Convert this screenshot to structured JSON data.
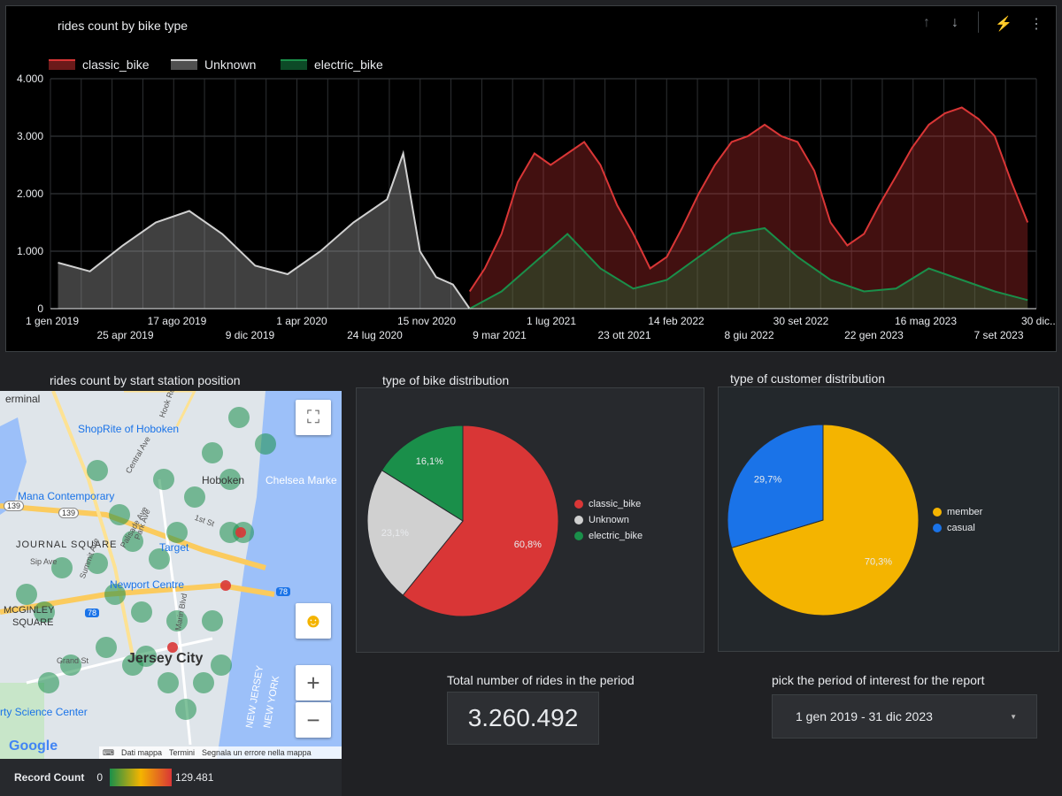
{
  "line_chart": {
    "title": "rides count by bike type",
    "legend": [
      {
        "name": "classic_bike",
        "color": "#d93636"
      },
      {
        "name": "Unknown",
        "color": "#d0d0d0"
      },
      {
        "name": "electric_bike",
        "color": "#1a8f4a"
      }
    ],
    "toolbar_icons": [
      "arrow-up-icon",
      "arrow-down-icon",
      "bolt-icon",
      "more-vert-icon"
    ],
    "y_ticks": [
      "0",
      "1.000",
      "2.000",
      "3.000",
      "4.000"
    ],
    "x_ticks_top": [
      "1 gen 2019",
      "17 ago 2019",
      "1 apr 2020",
      "15 nov 2020",
      "1 lug 2021",
      "14 feb 2022",
      "30 set 2022",
      "16 mag 2023",
      "30 dic..."
    ],
    "x_ticks_bottom": [
      "25 apr 2019",
      "9 dic 2019",
      "24 lug 2020",
      "9 mar 2021",
      "23 ott 2021",
      "8 giu 2022",
      "22 gen 2023",
      "7 set 2023"
    ]
  },
  "chart_data": [
    {
      "type": "area",
      "title": "rides count by bike type",
      "x_range": [
        "2019-01-01",
        "2023-12-31"
      ],
      "ylim": [
        0,
        4000
      ],
      "grid": true,
      "legend_position": "top-left",
      "series": [
        {
          "name": "Unknown",
          "x": [
            "2019-01",
            "2019-03",
            "2019-05",
            "2019-07",
            "2019-09",
            "2019-11",
            "2020-01",
            "2020-03",
            "2020-05",
            "2020-07",
            "2020-09",
            "2020-10",
            "2020-11",
            "2020-12",
            "2021-01",
            "2021-02"
          ],
          "values": [
            800,
            650,
            1100,
            1500,
            1700,
            1300,
            750,
            600,
            1000,
            1500,
            1900,
            2700,
            1000,
            550,
            420,
            0
          ]
        },
        {
          "name": "classic_bike",
          "x": [
            "2021-02",
            "2021-03",
            "2021-04",
            "2021-05",
            "2021-06",
            "2021-07",
            "2021-08",
            "2021-09",
            "2021-10",
            "2021-11",
            "2021-12",
            "2022-01",
            "2022-02",
            "2022-03",
            "2022-04",
            "2022-05",
            "2022-06",
            "2022-07",
            "2022-08",
            "2022-09",
            "2022-10",
            "2022-11",
            "2022-12",
            "2023-01",
            "2023-02",
            "2023-03",
            "2023-04",
            "2023-05",
            "2023-06",
            "2023-07",
            "2023-08",
            "2023-09",
            "2023-10",
            "2023-11",
            "2023-12"
          ],
          "values": [
            300,
            700,
            1300,
            2200,
            2700,
            2500,
            2700,
            2900,
            2500,
            1800,
            1300,
            700,
            900,
            1400,
            2000,
            2500,
            2900,
            3000,
            3200,
            3000,
            2900,
            2400,
            1500,
            1100,
            1300,
            1800,
            2300,
            2800,
            3200,
            3400,
            3500,
            3300,
            3000,
            2200,
            1500
          ]
        },
        {
          "name": "electric_bike",
          "x": [
            "2021-02",
            "2021-04",
            "2021-06",
            "2021-08",
            "2021-10",
            "2021-12",
            "2022-02",
            "2022-04",
            "2022-06",
            "2022-08",
            "2022-10",
            "2022-12",
            "2023-02",
            "2023-04",
            "2023-06",
            "2023-08",
            "2023-10",
            "2023-12"
          ],
          "values": [
            0,
            300,
            800,
            1300,
            700,
            350,
            500,
            900,
            1300,
            1400,
            900,
            500,
            300,
            350,
            700,
            500,
            300,
            150
          ]
        }
      ]
    },
    {
      "type": "pie",
      "title": "type of bike distribution",
      "categories": [
        "classic_bike",
        "Unknown",
        "electric_bike"
      ],
      "values": [
        60.8,
        23.1,
        16.1
      ],
      "labels": [
        "60,8%",
        "23,1%",
        "16,1%"
      ],
      "colors": [
        "#d93636",
        "#d0d0d0",
        "#1a8f4a"
      ],
      "legend_position": "right"
    },
    {
      "type": "pie",
      "title": "type of customer distribution",
      "categories": [
        "member",
        "casual"
      ],
      "values": [
        70.3,
        29.7
      ],
      "labels": [
        "70,3%",
        "29,7%"
      ],
      "colors": [
        "#f4b400",
        "#1a73e8"
      ],
      "legend_position": "right"
    }
  ],
  "map": {
    "title": "rides count by start station position",
    "labels": [
      "erminal",
      "ShopRite of Hoboken",
      "Hoboken",
      "Chelsea Marke",
      "Mana Contemporary",
      "JOURNAL SQUARE",
      "Target",
      "Newport Centre",
      "MCGINLEY",
      "SQUARE",
      "Jersey City",
      "rty Science Center",
      "NEW JERSEY",
      "NEW YORK",
      "Central Ave",
      "Sip Ave",
      "Grand St",
      "Marin Blvd",
      "Summit Ave",
      "Palisade Ave",
      "1st St",
      "Park Ave",
      "Hook Rd",
      "139",
      "139",
      "78",
      "78"
    ],
    "fullscreen_icon": "fullscreen-icon",
    "pegman_icon": "pegman-icon",
    "zoom_in": "+",
    "zoom_out": "−",
    "google_logo": "Google",
    "footer": {
      "keyboard_icon": "keyboard-icon",
      "data": "Dati mappa",
      "terms": "Termini",
      "report": "Segnala un errore nella mappa"
    },
    "scale": {
      "label": "Record Count",
      "min": "0",
      "max": "129.481"
    }
  },
  "scorecard": {
    "title": "Total number of rides in the period",
    "value": "3.260.492"
  },
  "date_picker": {
    "title": "pick the period of interest for the report",
    "value": "1 gen 2019 - 31 dic 2023",
    "dropdown_icon": "dropdown-arrow-icon"
  }
}
